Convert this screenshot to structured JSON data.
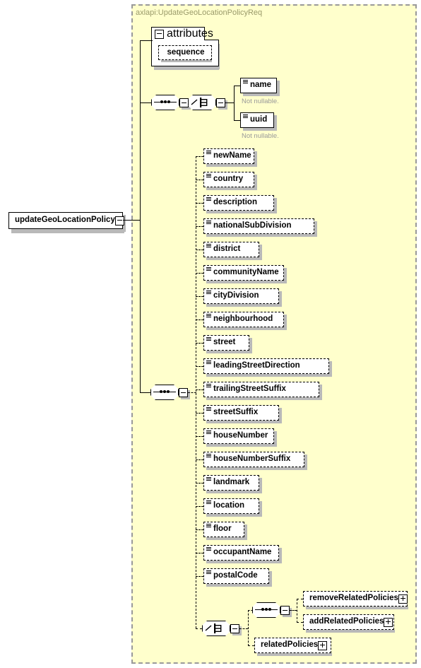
{
  "diagram": {
    "kind": "xml-schema-diagram",
    "root_element": {
      "name": "updateGeoLocationPolicy",
      "expander": "minus"
    },
    "complex_type": {
      "title": "axlapi:UpdateGeoLocationPolicyReq",
      "background": "#ffffcc",
      "border_color": "#999999"
    },
    "attributes_group": {
      "label": "attributes",
      "expander": "minus",
      "children": [
        {
          "name": "sequence",
          "optional": true
        }
      ]
    },
    "compositors": {
      "top_sequence": {
        "type": "sequence",
        "label": "sequence"
      },
      "top_choice": {
        "type": "choice",
        "label": "choice"
      },
      "main_sequence": {
        "type": "sequence",
        "label": "sequence",
        "optional": true
      },
      "bottom_choice": {
        "type": "choice",
        "label": "choice",
        "optional": true
      },
      "bottom_sequence": {
        "type": "sequence",
        "label": "sequence",
        "optional": true
      }
    },
    "required_elements": [
      {
        "name": "name",
        "annotation": "Not nullable."
      },
      {
        "name": "uuid",
        "annotation": "Not nullable."
      }
    ],
    "optional_elements": [
      {
        "name": "newName"
      },
      {
        "name": "country"
      },
      {
        "name": "description"
      },
      {
        "name": "nationalSubDivision"
      },
      {
        "name": "district"
      },
      {
        "name": "communityName"
      },
      {
        "name": "cityDivision"
      },
      {
        "name": "neighbourhood"
      },
      {
        "name": "street"
      },
      {
        "name": "leadingStreetDirection"
      },
      {
        "name": "trailingStreetSuffix"
      },
      {
        "name": "streetSuffix"
      },
      {
        "name": "houseNumber"
      },
      {
        "name": "houseNumberSuffix"
      },
      {
        "name": "landmark"
      },
      {
        "name": "location"
      },
      {
        "name": "floor"
      },
      {
        "name": "occupantName"
      },
      {
        "name": "postalCode"
      }
    ],
    "policy_elements": [
      {
        "name": "removeRelatedPolicies",
        "expander": "plus"
      },
      {
        "name": "addRelatedPolicies",
        "expander": "plus"
      },
      {
        "name": "relatedPolicies",
        "expander": "plus"
      }
    ]
  }
}
